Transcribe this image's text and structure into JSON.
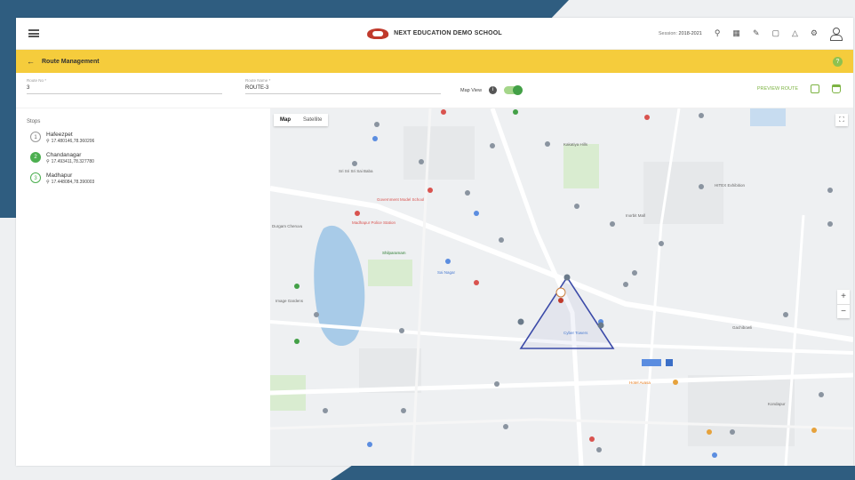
{
  "header": {
    "school_name": "NEXT EDUCATION DEMO SCHOOL",
    "session_label": "Session:",
    "session_value": "2018-2021"
  },
  "page": {
    "title": "Route Management"
  },
  "form": {
    "route_no_label": "Route No *",
    "route_no_value": "3",
    "route_name_label": "Route Name *",
    "route_name_value": "ROUTE-3",
    "map_view_label": "Map View",
    "map_view_on": true,
    "preview_label": "PREVIEW ROUTE"
  },
  "stops": {
    "title": "Stops",
    "items": [
      {
        "number": "1",
        "name": "Hafeezpet",
        "coords": "17.480146,78.360206"
      },
      {
        "number": "2",
        "name": "Chandanagar",
        "coords": "17.493411,78.327780"
      },
      {
        "number": "3",
        "name": "Madhapur",
        "coords": "17.448084,78.390003"
      }
    ]
  },
  "map": {
    "tab_map": "Map",
    "tab_satellite": "Satellite",
    "zoom_in": "+",
    "zoom_out": "−",
    "places": [
      {
        "text": "Sri Sri Sri Sai Baba",
        "color": "",
        "name": "place-sai-baba"
      },
      {
        "text": "Government Model School",
        "color": "red",
        "name": "place-govt-school"
      },
      {
        "text": "Madhapur Police Station",
        "color": "red",
        "name": "place-police-station"
      },
      {
        "text": "Durgam Cheruvu",
        "color": "",
        "name": "place-durgam"
      },
      {
        "text": "Sai Nagar",
        "color": "blue",
        "name": "place-sai-nagar"
      },
      {
        "text": "Shilparamam",
        "color": "green",
        "name": "place-shilparamam"
      },
      {
        "text": "Kakatiya Hills",
        "color": "",
        "name": "place-kakatiya"
      },
      {
        "text": "HITEX Exhibition",
        "color": "",
        "name": "place-hitex"
      },
      {
        "text": "Inorbit Mall",
        "color": "",
        "name": "place-inorbit"
      },
      {
        "text": "Hotel Avasa",
        "color": "orange",
        "name": "place-avasa"
      },
      {
        "text": "Image Gardens",
        "color": "",
        "name": "place-image-gardens"
      },
      {
        "text": "Cyber Towers",
        "color": "blue",
        "name": "place-cyber-towers"
      },
      {
        "text": "Gachibowli",
        "color": "",
        "name": "place-gachibowli"
      },
      {
        "text": "Kondapur",
        "color": "",
        "name": "place-kondapur"
      }
    ]
  },
  "icons": {
    "menu": "menu-icon",
    "search": "search-icon",
    "calendar": "calendar-icon",
    "edit": "edit-icon",
    "message": "message-icon",
    "bell": "bell-icon",
    "settings": "settings-icon",
    "user": "user-icon"
  },
  "colors": {
    "frame": "#2f5d80",
    "header_yellow": "#f5cc3c",
    "accent_green": "#4caf50",
    "route_triangle": "#3b4aa8"
  }
}
